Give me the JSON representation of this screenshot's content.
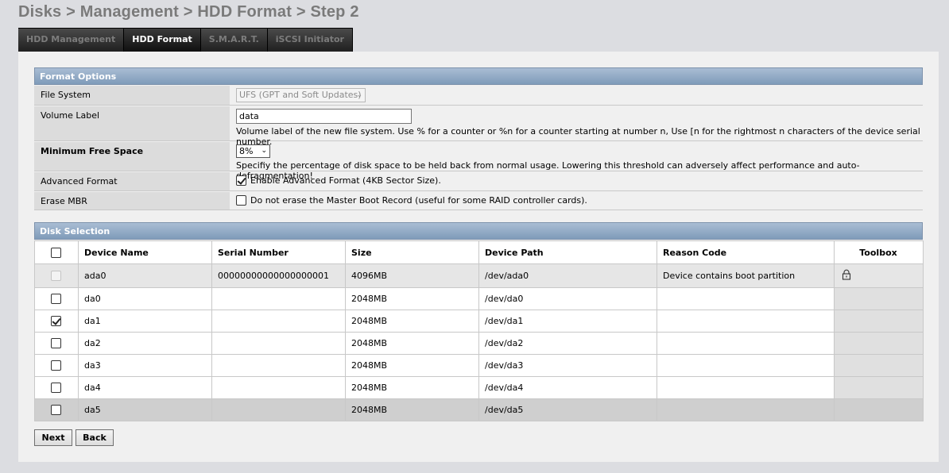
{
  "breadcrumb": "Disks > Management > HDD Format > Step 2",
  "tabs": [
    {
      "label": "HDD Management",
      "active": false
    },
    {
      "label": "HDD Format",
      "active": true
    },
    {
      "label": "S.M.A.R.T.",
      "active": false
    },
    {
      "label": "iSCSI Initiator",
      "active": false
    }
  ],
  "format_options": {
    "header": "Format Options",
    "file_system": {
      "label": "File System",
      "value": "UFS (GPT and Soft Updates)"
    },
    "volume_label": {
      "label": "Volume Label",
      "value": "data",
      "hint": "Volume label of the new file system. Use % for a counter or %n for a counter starting at number n, Use [n for the rightmost n characters of the device serial number."
    },
    "min_free_space": {
      "label": "Minimum Free Space",
      "value": "8%",
      "hint": "Specifiy the percentage of disk space to be held back from normal usage. Lowering this threshold can adversely affect performance and auto-defragmentation!"
    },
    "advanced_format": {
      "label": "Advanced Format",
      "checked": true,
      "text": "Enable Advanced Format (4KB Sector Size)."
    },
    "erase_mbr": {
      "label": "Erase MBR",
      "checked": false,
      "text": "Do not erase the Master Boot Record (useful for some RAID controller cards)."
    }
  },
  "disk_selection": {
    "header": "Disk Selection",
    "columns": [
      "Device Name",
      "Serial Number",
      "Size",
      "Device Path",
      "Reason Code",
      "Toolbox"
    ],
    "rows": [
      {
        "name": "ada0",
        "serial": "00000000000000000001",
        "size": "4096MB",
        "path": "/dev/ada0",
        "reason": "Device contains boot partition",
        "checked": false,
        "disabled": true,
        "locked": true
      },
      {
        "name": "da0",
        "serial": "",
        "size": "2048MB",
        "path": "/dev/da0",
        "reason": "",
        "checked": false,
        "disabled": false,
        "locked": false
      },
      {
        "name": "da1",
        "serial": "",
        "size": "2048MB",
        "path": "/dev/da1",
        "reason": "",
        "checked": true,
        "disabled": false,
        "locked": false
      },
      {
        "name": "da2",
        "serial": "",
        "size": "2048MB",
        "path": "/dev/da2",
        "reason": "",
        "checked": false,
        "disabled": false,
        "locked": false
      },
      {
        "name": "da3",
        "serial": "",
        "size": "2048MB",
        "path": "/dev/da3",
        "reason": "",
        "checked": false,
        "disabled": false,
        "locked": false
      },
      {
        "name": "da4",
        "serial": "",
        "size": "2048MB",
        "path": "/dev/da4",
        "reason": "",
        "checked": false,
        "disabled": false,
        "locked": false
      },
      {
        "name": "da5",
        "serial": "",
        "size": "2048MB",
        "path": "/dev/da5",
        "reason": "",
        "checked": false,
        "disabled": false,
        "locked": false
      }
    ]
  },
  "buttons": {
    "next": "Next",
    "back": "Back"
  },
  "colors": {
    "section_header": "#8fa8c3",
    "tab_bar": "#202020",
    "background": "#dcdde1"
  },
  "icons": {
    "toolbox_lock": "lock-icon"
  }
}
